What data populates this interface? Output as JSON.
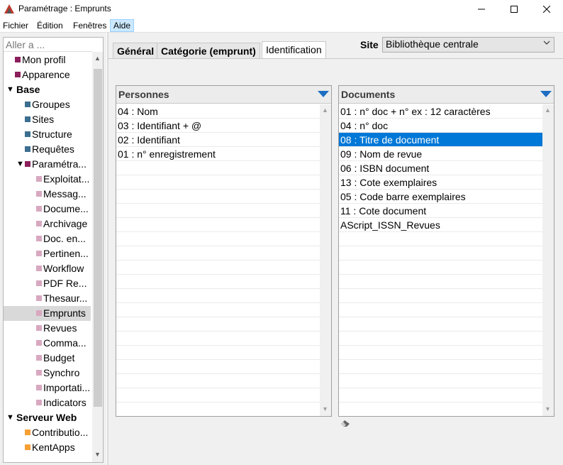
{
  "window": {
    "title": "Paramétrage : Emprunts",
    "controls": [
      "minimize",
      "maximize",
      "close"
    ]
  },
  "menubar": {
    "items": [
      "Fichier",
      "Édition",
      "Fenêtres",
      "Aide"
    ]
  },
  "sidebar": {
    "goto_placeholder": "Aller a ...",
    "items": [
      {
        "label": "Mon profil",
        "color": "#8b1f5b"
      },
      {
        "label": "Apparence",
        "color": "#8b1f5b"
      },
      {
        "label": "Base"
      },
      {
        "label": "Groupes",
        "color": "#3c6e8f"
      },
      {
        "label": "Sites",
        "color": "#3c6e8f"
      },
      {
        "label": "Structure",
        "color": "#3c6e8f"
      },
      {
        "label": "Requêtes",
        "color": "#3c6e8f"
      },
      {
        "label": "Paramétra...",
        "color": "#8b1f5b"
      },
      {
        "label": "Exploitat...",
        "color": "#d8a8c0"
      },
      {
        "label": "Messag...",
        "color": "#d8a8c0"
      },
      {
        "label": "Docume...",
        "color": "#d8a8c0"
      },
      {
        "label": "Archivage",
        "color": "#d8a8c0"
      },
      {
        "label": "Doc. en...",
        "color": "#d8a8c0"
      },
      {
        "label": "Pertinen...",
        "color": "#d8a8c0"
      },
      {
        "label": "Workflow",
        "color": "#d8a8c0"
      },
      {
        "label": "PDF Re...",
        "color": "#d8a8c0"
      },
      {
        "label": "Thesaur...",
        "color": "#d8a8c0"
      },
      {
        "label": "Emprunts",
        "color": "#d8a8c0"
      },
      {
        "label": "Revues",
        "color": "#d8a8c0"
      },
      {
        "label": "Comma...",
        "color": "#d8a8c0"
      },
      {
        "label": "Budget",
        "color": "#d8a8c0"
      },
      {
        "label": "Synchro",
        "color": "#d8a8c0"
      },
      {
        "label": "Importati...",
        "color": "#d8a8c0"
      },
      {
        "label": "Indicators",
        "color": "#d8a8c0"
      },
      {
        "label": "Serveur Web"
      },
      {
        "label": "Contributio...",
        "color": "#f7a033"
      },
      {
        "label": "KentApps",
        "color": "#f7a033"
      }
    ]
  },
  "tabs": [
    "Général",
    "Catégorie (emprunt)",
    "Identification"
  ],
  "site": {
    "label": "Site",
    "value": "Bibliothèque centrale"
  },
  "personnes": {
    "title": "Personnes",
    "rows": [
      "04 : Nom",
      "03 : Identifiant + @",
      "02 : Identifiant",
      "01 : n° enregistrement"
    ]
  },
  "documents": {
    "title": "Documents",
    "rows": [
      "01 : n° doc + n° ex : 12 caractères",
      "04 : n° doc",
      "08 : Titre de document",
      "09 : Nom de revue",
      "06 : ISBN document",
      "13 : Cote exemplaires",
      "05 : Code barre exemplaires",
      "11 : Cote document",
      "AScript_ISSN_Revues"
    ],
    "selected": "08 : Titre de document"
  },
  "colors": {
    "selection": "#0078d7",
    "sort_arrow": "#1e6fc2"
  }
}
